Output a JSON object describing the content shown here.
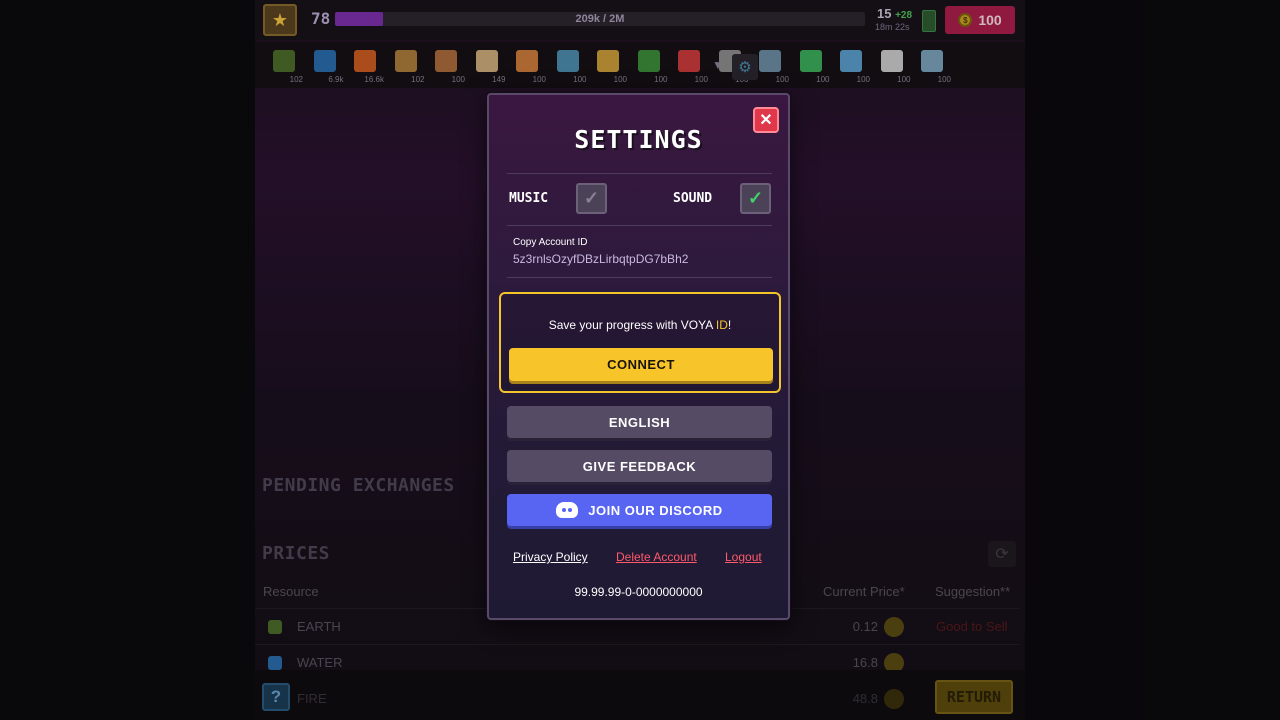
{
  "hud": {
    "level": "78",
    "xp_text": "209k / 2M",
    "xp_fraction": 0.09,
    "energy": "15",
    "energy_bonus": "+28",
    "energy_timer": "18m 22s",
    "coins": "100",
    "coin_glyph": "$"
  },
  "resources": [
    {
      "icon": "earth-icon",
      "count": "102",
      "color": "#4a6a2a"
    },
    {
      "icon": "water-icon",
      "count": "6.9k",
      "color": "#2a6aaa"
    },
    {
      "icon": "fire-icon",
      "count": "16.6k",
      "color": "#c85a20"
    },
    {
      "icon": "resource-4-icon",
      "count": "102",
      "color": "#a87a3a"
    },
    {
      "icon": "resource-5-icon",
      "count": "100",
      "color": "#a86a3a"
    },
    {
      "icon": "resource-6-icon",
      "count": "149",
      "color": "#c8a87a"
    },
    {
      "icon": "resource-7-icon",
      "count": "100",
      "color": "#c87a3a"
    },
    {
      "icon": "resource-8-icon",
      "count": "100",
      "color": "#4a8aaa"
    },
    {
      "icon": "resource-9-icon",
      "count": "100",
      "color": "#c89a3a"
    },
    {
      "icon": "resource-10-icon",
      "count": "100",
      "color": "#3a8a3a"
    },
    {
      "icon": "resource-11-icon",
      "count": "100",
      "color": "#c83a3a"
    },
    {
      "icon": "resource-12-icon",
      "count": "100",
      "color": "#8a8a8a"
    },
    {
      "icon": "resource-13-icon",
      "count": "100",
      "color": "#6a8aa0"
    },
    {
      "icon": "resource-14-icon",
      "count": "100",
      "color": "#3aaa5a"
    },
    {
      "icon": "resource-15-icon",
      "count": "100",
      "color": "#5a9ac8"
    },
    {
      "icon": "resource-16-icon",
      "count": "100",
      "color": "#c8c8c8"
    },
    {
      "icon": "resource-17-icon",
      "count": "100",
      "color": "#7aa0b8"
    }
  ],
  "background": {
    "pending_title": "PENDING EXCHANGES",
    "prices_title": "PRICES",
    "col_resource": "Resource",
    "col_price": "Current Price*",
    "col_suggestion": "Suggestion**",
    "rows": [
      {
        "name": "EARTH",
        "price": "0.12",
        "suggestion": "Good to Sell",
        "icon_color": "#4a6a2a"
      },
      {
        "name": "WATER",
        "price": "16.8",
        "suggestion": "",
        "icon_color": "#2a6aaa"
      },
      {
        "name": "FIRE",
        "price": "48.8",
        "suggestion": "",
        "icon_color": "#8a3a20"
      }
    ],
    "help_label": "?",
    "return_label": "RETURN"
  },
  "settings": {
    "title": "SETTINGS",
    "close_glyph": "✕",
    "music_label": "MUSIC",
    "music_on": false,
    "sound_label": "SOUND",
    "sound_on": true,
    "check_glyph": "✓",
    "account_label": "Copy Account ID",
    "account_id": "5z3rnlsOzyfDBzLirbqtpDG7bBh2",
    "voya_prefix": "Save your progress with VOYA ",
    "voya_highlight": "ID",
    "voya_suffix": "!",
    "connect_label": "CONNECT",
    "language_label": "ENGLISH",
    "feedback_label": "GIVE FEEDBACK",
    "discord_label": "JOIN OUR DISCORD",
    "privacy_label": "Privacy Policy",
    "delete_label": "Delete Account",
    "logout_label": "Logout",
    "version": "99.99.99-0-0000000000",
    "accent_yellow": "#f7c52a",
    "accent_red": "#e0374b",
    "discord_blue": "#5865f2"
  }
}
